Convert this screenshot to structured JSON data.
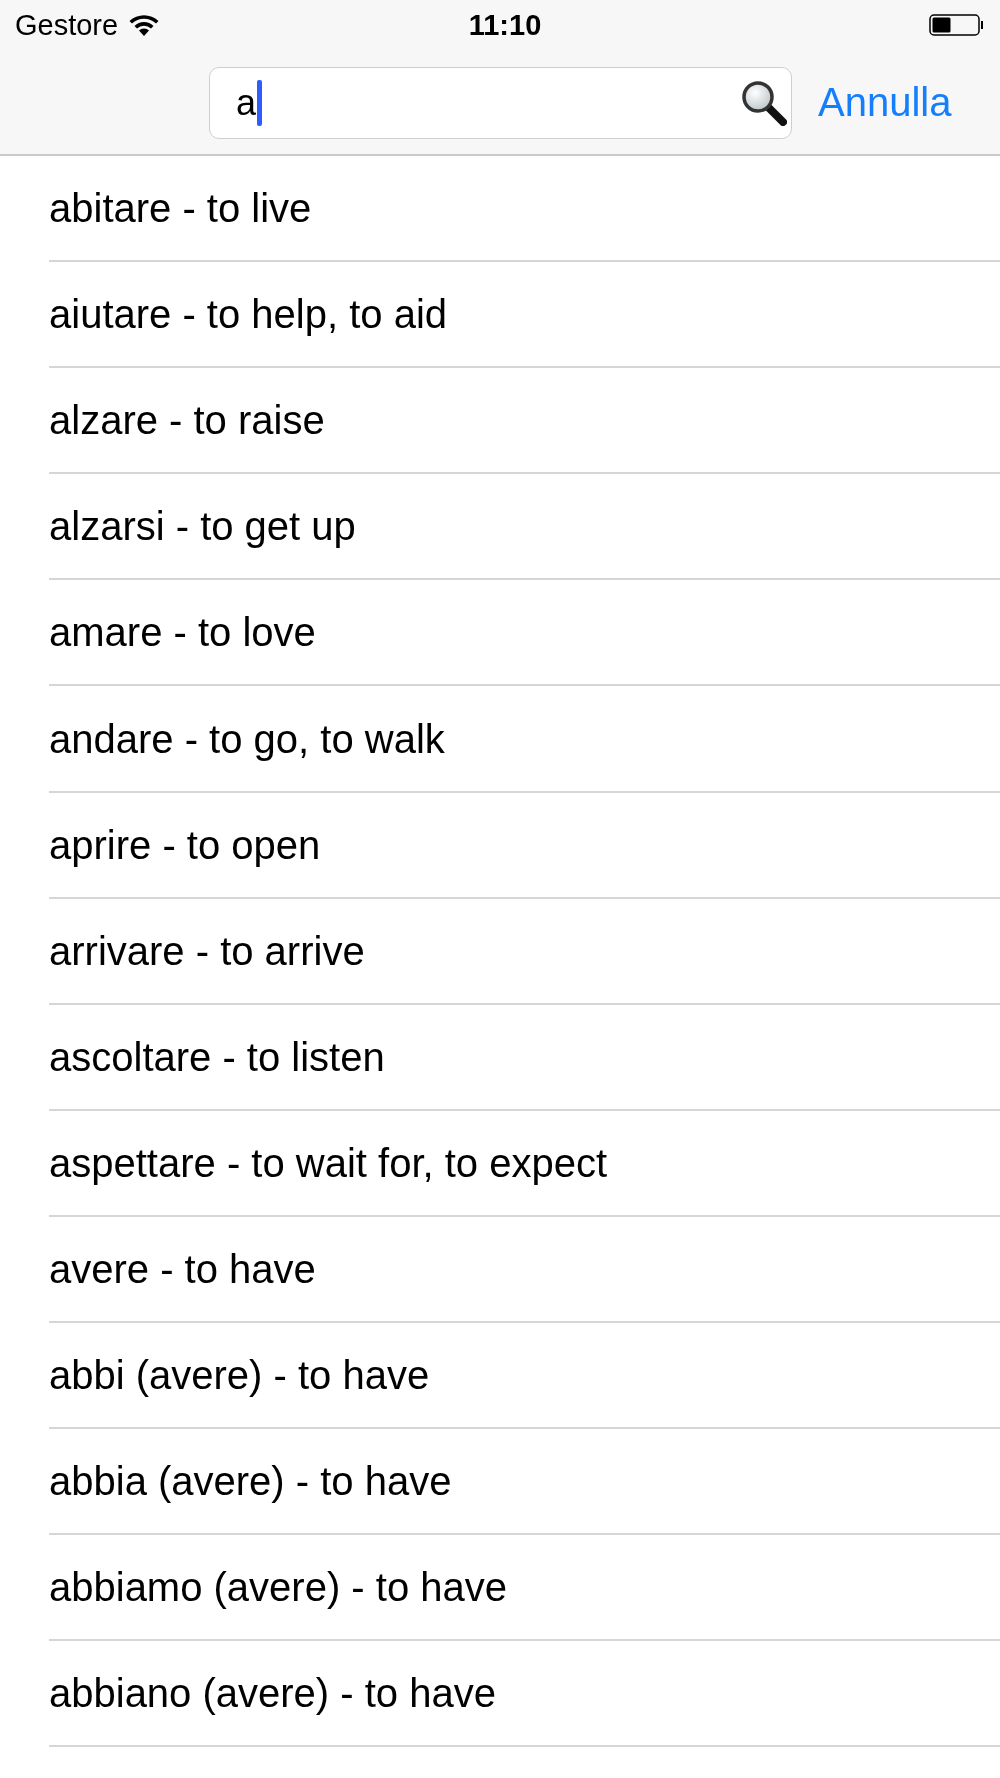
{
  "status_bar": {
    "carrier": "Gestore",
    "time": "11:10"
  },
  "search": {
    "value": "a",
    "cancel": "Annulla"
  },
  "results": [
    {
      "text": "abitare - to live"
    },
    {
      "text": "aiutare - to help, to aid"
    },
    {
      "text": "alzare - to raise"
    },
    {
      "text": "alzarsi - to get up"
    },
    {
      "text": "amare - to love"
    },
    {
      "text": "andare - to go, to walk"
    },
    {
      "text": "aprire - to open"
    },
    {
      "text": "arrivare - to arrive"
    },
    {
      "text": "ascoltare - to listen"
    },
    {
      "text": "aspettare - to wait for, to expect"
    },
    {
      "text": "avere - to have"
    },
    {
      "text": "abbi (avere) - to have"
    },
    {
      "text": "abbia (avere) - to have"
    },
    {
      "text": "abbiamo (avere) - to have"
    },
    {
      "text": "abbiano (avere) - to have"
    }
  ]
}
